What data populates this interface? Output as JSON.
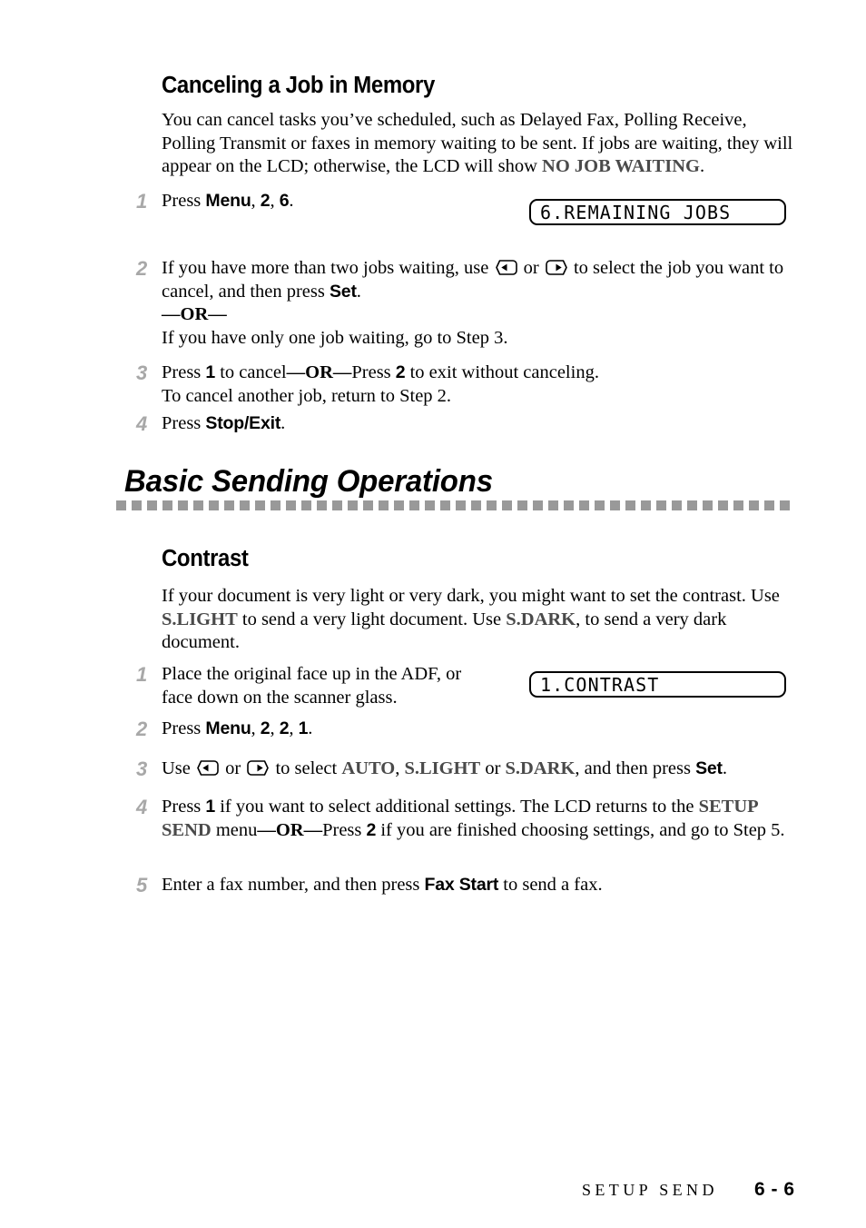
{
  "section_one": {
    "heading": "Canceling a Job in Memory",
    "intro_part1": "You can cancel tasks you’ve scheduled, such as Delayed Fax, Polling Receive, Polling Transmit or faxes in memory waiting to be sent. If jobs are waiting, they will appear on the LCD; otherwise, the LCD will show ",
    "intro_lcd_token": "NO JOB WAITING",
    "intro_part2": ".",
    "steps": [
      {
        "number": "1",
        "text_part1": "Press ",
        "key1": "Menu",
        "sep1": ", ",
        "key2": "2",
        "sep2": ", ",
        "key3": "6",
        "text_part2": "."
      },
      {
        "number": "2",
        "line1_part1": "If you have more than two jobs waiting, use ",
        "arrow_left": "left-arrow-key",
        "line1_mid": " or ",
        "arrow_right": "right-arrow-key",
        "line1_part2": " to select the job you want to cancel, and then press ",
        "key_set": "Set",
        "line1_part3": ".",
        "line2": "—OR—",
        "line3": "If you have only one job waiting, go to Step 3."
      },
      {
        "number": "3",
        "line1_part1": "Press ",
        "key1": "1",
        "line1_part2": " to cancel",
        "or_token": "—OR—",
        "line1_part3": "Press ",
        "key2": "2",
        "line1_part4": " to exit without canceling.",
        "line2": "To cancel another job, return to Step 2."
      },
      {
        "number": "4",
        "text_part1": "Press ",
        "key1": "Stop/Exit",
        "text_part2": "."
      }
    ],
    "lcd": {
      "value": "6.REMAINING JOBS"
    }
  },
  "banner": {
    "title": "Basic Sending Operations",
    "rule_color": "#999999"
  },
  "section_two": {
    "heading": "Contrast",
    "intro_part1": "If your document is very light or very dark, you might want to set the contrast. Use ",
    "intro_token1": "S.LIGHT",
    "intro_part2": " to send a very light document. Use ",
    "intro_token2": "S.DARK",
    "intro_part3": ", to send a very dark document.",
    "steps": [
      {
        "number": "1",
        "line1": "Place the original face up in the ADF, or",
        "line2": "face down on the scanner glass."
      },
      {
        "number": "2",
        "text_part1": "Press ",
        "key1": "Menu",
        "sep1": ", ",
        "key2": "2",
        "sep2": ", ",
        "key3": "2",
        "sep3": ", ",
        "key4": "1",
        "text_part2": "."
      },
      {
        "number": "3",
        "part1": "Use ",
        "arrow_left": "left-arrow-key",
        "mid": " or ",
        "arrow_right": "right-arrow-key",
        "part2": " to select ",
        "token_auto": "AUTO",
        "sep1": ", ",
        "token_slight": "S.LIGHT",
        "sep2": " or ",
        "token_sdark": "S.DARK",
        "part3": ", and then press ",
        "key_set": "Set",
        "part4": "."
      },
      {
        "number": "4",
        "part1": "Press ",
        "key1": "1",
        "part2": " if you want to select additional settings. The LCD returns to the ",
        "token_setup_send": "SETUP SEND",
        "part3": " menu",
        "or_token": "—OR—",
        "part4": "Press ",
        "key2": "2",
        "part5": " if you are finished choosing settings, and go to Step 5."
      },
      {
        "number": "5",
        "part1": "Enter a fax number, and then press ",
        "key1": "Fax Start",
        "part2": " to send a fax."
      }
    ],
    "lcd": {
      "value": "1.CONTRAST"
    }
  },
  "footer": {
    "chapter_label": "SETUP SEND",
    "page_number": "6 - 6"
  }
}
